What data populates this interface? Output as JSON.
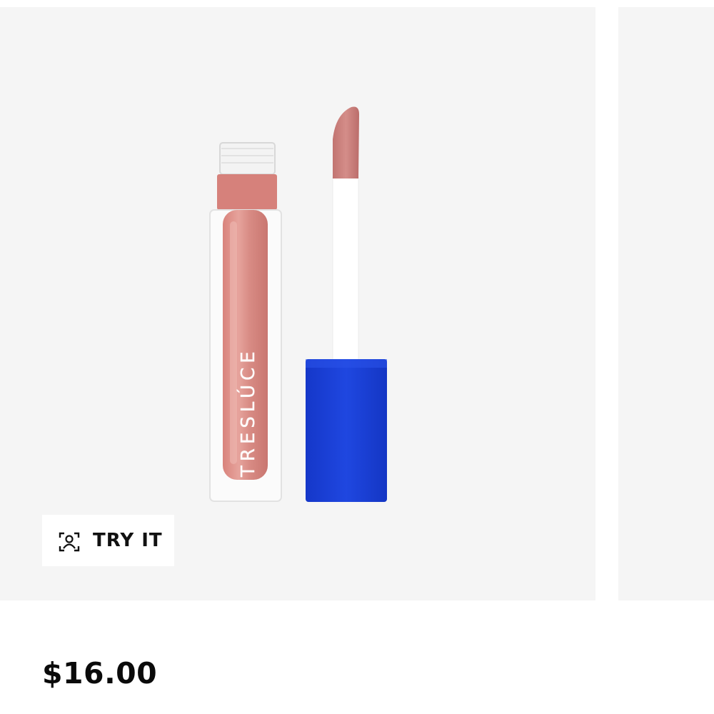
{
  "product": {
    "brand_on_tube": "TRESLÚCE",
    "try_it_label": "TRY IT",
    "price": "$16.00",
    "icon": "face-scan-icon",
    "colors": {
      "image_background": "#f5f5f5",
      "gloss_shade": "#d98a84",
      "cap": "#1a3fd6",
      "applicator_tip": "#c97c7a"
    }
  }
}
